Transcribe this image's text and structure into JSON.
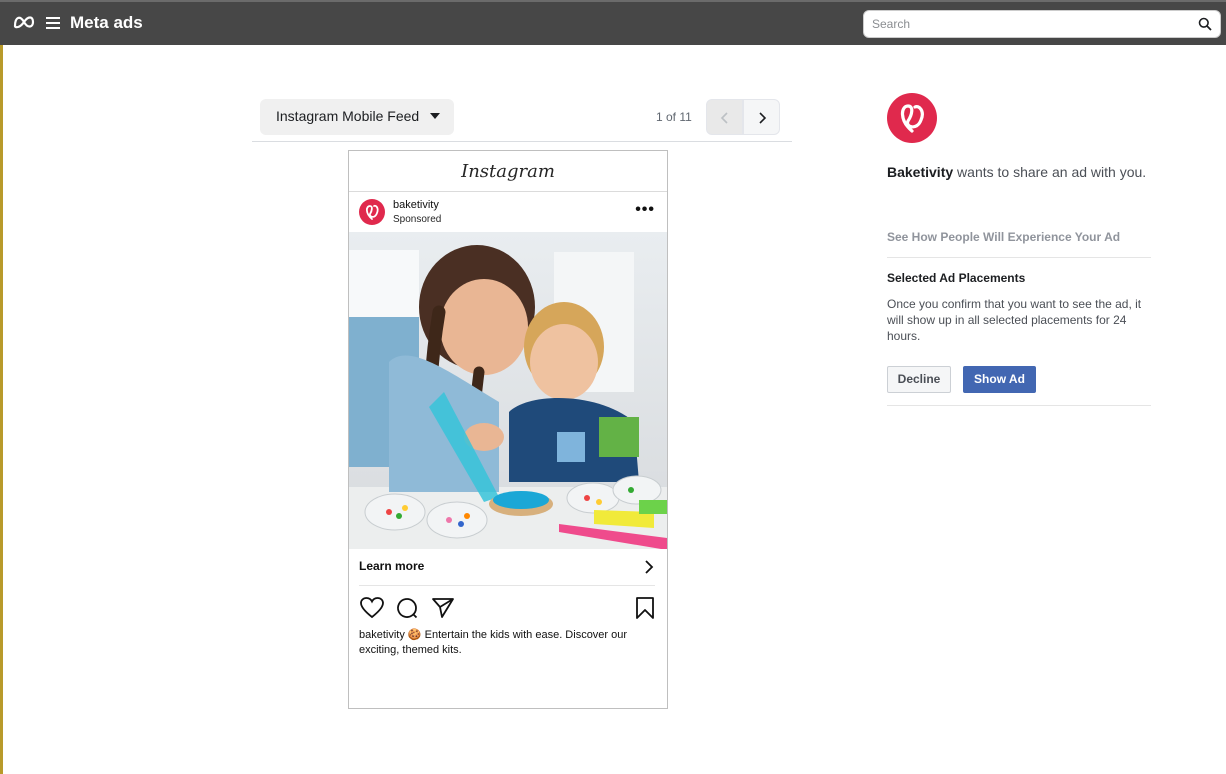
{
  "topbar": {
    "brand": "Meta ads",
    "search_placeholder": "Search"
  },
  "preview": {
    "placement_label": "Instagram Mobile Feed",
    "pager": "1 of 11"
  },
  "ad": {
    "platform_wordmark": "Instagram",
    "account": "baketivity",
    "sponsored": "Sponsored",
    "cta": "Learn more",
    "caption_account": "baketivity",
    "caption_text": "🍪 Entertain the kids with ease. Discover our exciting, themed kits."
  },
  "side": {
    "advertiser": "Baketivity",
    "share_suffix": " wants to share an ad with you.",
    "see_how": "See How People Will Experience Your Ad",
    "selected_title": "Selected Ad Placements",
    "selected_desc": "Once you confirm that you want to see the ad, it will show up in all selected placements for 24 hours.",
    "decline": "Decline",
    "show": "Show Ad"
  },
  "colors": {
    "topbar": "#474747",
    "brand_red": "#e0294d",
    "primary_button": "#4267b2"
  }
}
